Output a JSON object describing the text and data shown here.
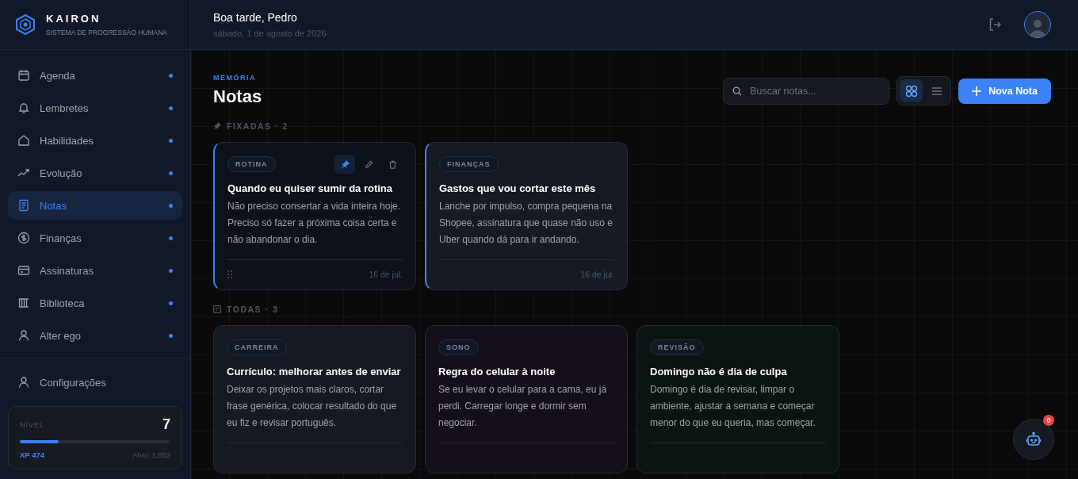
{
  "brand": {
    "name": "KAIRON",
    "subtitle": "SISTEMA DE PROGRESSÃO HUMANA"
  },
  "sidebar": {
    "items": [
      {
        "kind": "calendar",
        "label": "Agenda",
        "selected": false
      },
      {
        "kind": "bell",
        "label": "Lembretes",
        "selected": false
      },
      {
        "kind": "house",
        "label": "Habilidades",
        "selected": false
      },
      {
        "kind": "trend",
        "label": "Evolução",
        "selected": false
      },
      {
        "kind": "note",
        "label": "Notas",
        "selected": true
      },
      {
        "kind": "dollar",
        "label": "Finanças",
        "selected": false
      },
      {
        "kind": "card",
        "label": "Assinaturas",
        "selected": false
      },
      {
        "kind": "books",
        "label": "Biblioteca",
        "selected": false
      },
      {
        "kind": "user",
        "label": "Alter ego",
        "selected": false
      }
    ],
    "settings": {
      "label": "Configurações"
    },
    "level": {
      "label": "NÍVEL",
      "value": "7",
      "level": 0.256,
      "xp": "XP 474",
      "target": "Alvo: 1,852"
    }
  },
  "header": {
    "greeting": "Boa tarde, Pedro",
    "date": "sábado, 1 de agosto de 2026"
  },
  "page": {
    "eyebrow": "MEMÓRIA",
    "title": "Notas",
    "search": {
      "placeholder": "Buscar notas..."
    },
    "views": [
      {
        "kind": "grid",
        "selected": true
      },
      {
        "kind": "list",
        "selected": false
      }
    ],
    "new_button": "Nova Nota"
  },
  "sections": [
    {
      "kind": "pinned",
      "label": "FIXADAS · 2",
      "notes": [
        {
          "tag": "ROTINA",
          "title": "Quando eu quiser sumir da rotina",
          "body": "Não preciso consertar a vida inteira hoje. Preciso só fazer a próxima coisa certa e não abandonar o dia.",
          "date": "16 de jul.",
          "selected": true,
          "color": "#0d111a"
        },
        {
          "tag": "FINANÇAS",
          "title": "Gastos que vou cortar este mês",
          "body": "Lanche por impulso, compra pequena na Shopee, assinatura que quase não uso e Uber quando dá para ir andando.",
          "date": "16 de jul.",
          "selected": false,
          "color": "#151a23"
        }
      ]
    },
    {
      "kind": "all",
      "label": "TODAS · 3",
      "notes": [
        {
          "tag": "CARREIRA",
          "title": "Currículo: melhorar antes de enviar",
          "body": "Deixar os projetos mais claros, cortar frase genérica, colocar resultado do que eu fiz e revisar português.",
          "selected": false,
          "color": "#151a22"
        },
        {
          "tag": "SONO",
          "title": "Regra do celular à noite",
          "body": "Se eu levar o celular para a cama, eu já perdi. Carregar longe e dormir sem negociar.",
          "selected": false,
          "color": "#150f1b"
        },
        {
          "tag": "REVISÃO",
          "title": "Domingo não é dia de culpa",
          "body": "Domingo é dia de revisar, limpar o ambiente, ajustar a semana e começar menor do que eu queria, mas começar.",
          "selected": false,
          "color": "#0c140f"
        }
      ]
    }
  ],
  "assistant": {
    "badge": "0"
  }
}
